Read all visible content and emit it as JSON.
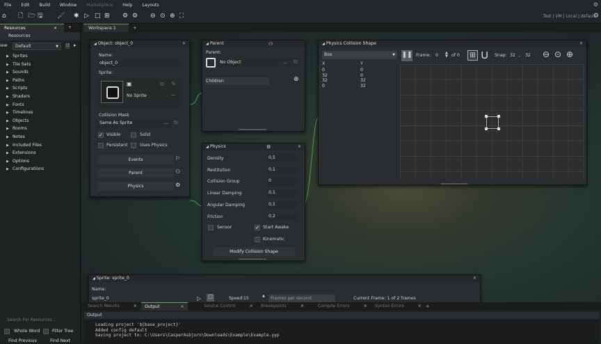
{
  "menu": {
    "items": [
      "File",
      "Edit",
      "Build",
      "Window"
    ],
    "marketplace": "Marketplace",
    "items2": [
      "Help",
      "Layouts"
    ]
  },
  "toolbar": {
    "right_status": "Test | VM | Local | default",
    "icons": [
      "home-icon",
      "new-file-icon",
      "open-folder-icon",
      "save-icon",
      "clean-icon",
      "debug-icon",
      "play-icon",
      "stop-icon",
      "build-icon",
      "game-options-icon",
      "preferences-icon",
      "zoom-out-icon",
      "zoom-reset-icon",
      "zoom-in-icon",
      "fullscreen-icon"
    ]
  },
  "resources": {
    "tab_label": "Resources",
    "tab_close": "×",
    "tab_add": "+",
    "header": "Resources",
    "view_prefix": "iew",
    "config_select": "Default",
    "tree": [
      "Sprites",
      "Tile Sets",
      "Sounds",
      "Paths",
      "Scripts",
      "Shaders",
      "Fonts",
      "Timelines",
      "Objects",
      "Rooms",
      "Notes",
      "Included Files",
      "Extensions",
      "Options",
      "Configurations"
    ],
    "search_placeholder": "Search For Resources...",
    "whole_word": "Whole Word",
    "filter_tree": "Filter Tree",
    "find_previous": "Find Previous",
    "find_next": "Find Next"
  },
  "workspace": {
    "tab_label": "Workspace 1",
    "tab_add": "+"
  },
  "object_panel": {
    "title": "Object: object_0",
    "name_label": "Name:",
    "name_value": "object_0",
    "sprite_label": "Sprite:",
    "sprite_value": "No Sprite",
    "sprite_more": "...",
    "collision_label": "Collision Mask",
    "collision_value": "Same As Sprite",
    "collision_more": "...",
    "visible": "Visible",
    "solid": "Solid",
    "persistent": "Persistent",
    "uses_physics": "Uses Physics",
    "events_btn": "Events",
    "parent_btn": "Parent",
    "physics_btn": "Physics"
  },
  "parent_panel": {
    "title": "Parent",
    "parent_label": "Parent:",
    "parent_value": "No Object",
    "parent_more": "...",
    "children_label": "Children"
  },
  "physics_panel": {
    "title": "Physics",
    "props": [
      {
        "label": "Density",
        "value": "0,5"
      },
      {
        "label": "Restitution",
        "value": "0,1"
      },
      {
        "label": "Collision Group",
        "value": "0"
      },
      {
        "label": "Linear Damping",
        "value": "0,1"
      },
      {
        "label": "Angular Damping",
        "value": "0,1"
      },
      {
        "label": "Friction",
        "value": "0,2"
      }
    ],
    "sensor": "Sensor",
    "start_awake": "Start Awake",
    "kinematic": "Kinematic",
    "modify_btn": "Modify Collision Shape"
  },
  "collision_panel": {
    "title": "Physics Collision Shape",
    "shape_select": "Box",
    "col_x": "X",
    "col_y": "Y",
    "points": [
      [
        "0",
        "0"
      ],
      [
        "32",
        "0"
      ],
      [
        "32",
        "32"
      ],
      [
        "0",
        "32"
      ]
    ],
    "frame_label": "Frame:",
    "frame_value": "0",
    "frame_of": "of 0",
    "snap_label": "Snap:",
    "snap_x": "32",
    "snap_sep": ",",
    "snap_y": "32"
  },
  "sprite_panel": {
    "title": "Sprite: sprite_0",
    "name_label": "Name:",
    "name_value": "sprite_0",
    "speed_label": "Speed:",
    "speed_value": "15",
    "speed_mode": "Frames per second",
    "current_frame": "Current Frame: 1 of 2 frames"
  },
  "bottom_dock": {
    "tabs": [
      "Search Results",
      "Output",
      "Source Control",
      "Breakpoints",
      "Compile Errors",
      "Syntax Errors"
    ],
    "active_tab": "Output",
    "tab_close": "×",
    "tab_add": "+",
    "header": "Output",
    "lines": [
      "Loading project '${base_project}'",
      "Added config default",
      "Saving project to: C:\\Users\\CasperAsbjorn\\Downloads\\Example\\Example.yyp"
    ]
  }
}
